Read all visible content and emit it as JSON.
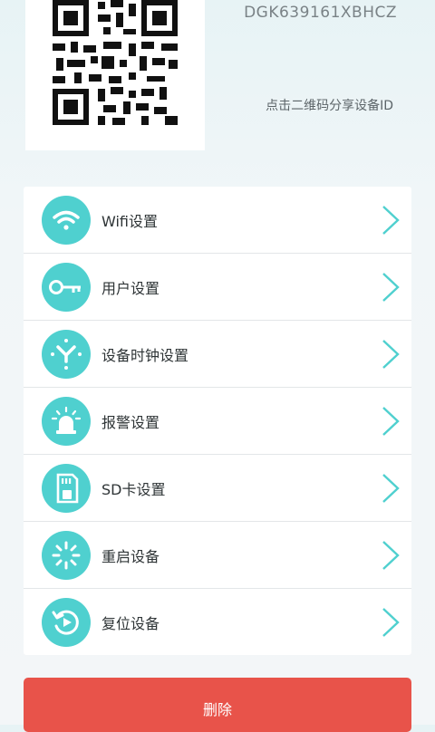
{
  "device": {
    "id": "DGK639161XBHCZ",
    "share_hint": "点击二维码分享设备ID"
  },
  "menu": {
    "items": [
      {
        "label": "Wifi设置",
        "icon": "wifi-icon"
      },
      {
        "label": "用户设置",
        "icon": "key-icon"
      },
      {
        "label": "设备时钟设置",
        "icon": "clock-icon"
      },
      {
        "label": "报警设置",
        "icon": "alarm-icon"
      },
      {
        "label": "SD卡设置",
        "icon": "sd-card-icon"
      },
      {
        "label": "重启设备",
        "icon": "restart-icon"
      },
      {
        "label": "复位设备",
        "icon": "reset-icon"
      }
    ]
  },
  "actions": {
    "delete_label": "删除"
  },
  "colors": {
    "accent": "#4fd0cf",
    "danger": "#e8534a"
  }
}
